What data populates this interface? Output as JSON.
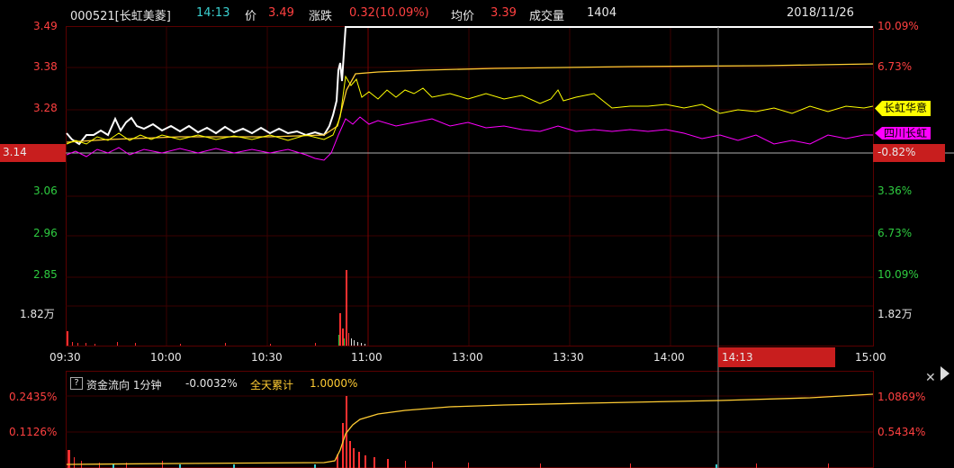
{
  "header": {
    "code_name": "000521[长虹美菱]",
    "time": "14:13",
    "price_label": "价",
    "price": "3.49",
    "change_label": "涨跌",
    "change": "0.32(10.09%)",
    "avg_label": "均价",
    "avg": "3.39",
    "volume_label": "成交量",
    "volume": "1404",
    "date": "2018/11/26"
  },
  "price_axis": {
    "left": [
      "3.49",
      "3.38",
      "3.28",
      "3.06",
      "2.96",
      "2.85",
      "1.82万"
    ],
    "right": [
      "10.09%",
      "6.73%",
      "3.36%",
      "6.73%",
      "10.09%",
      "1.82万"
    ],
    "prev_close": "3.14",
    "prev_close_pct": "-0.82%"
  },
  "time_axis": {
    "labels": [
      "09:30",
      "10:00",
      "10:30",
      "11:00",
      "13:00",
      "13:30",
      "14:00",
      "15:00"
    ],
    "cursor": "14:13"
  },
  "overlay_tags": [
    {
      "name": "长虹华意",
      "color": "#ffff00"
    },
    {
      "name": "四川长虹",
      "color": "#ff00ff"
    }
  ],
  "fund_panel": {
    "title": "资金流向 1分钟",
    "value": "-0.0032%",
    "cumulative_label": "全天累计",
    "cumulative": "1.0000%",
    "left_axis": [
      "0.2435%",
      "0.1126%"
    ],
    "right_axis": [
      "1.0869%",
      "0.5434%"
    ]
  },
  "colors": {
    "price_line": "#ffffff",
    "avg_line": "#ffcc33",
    "changhong_huayi": "#ffff00",
    "sichuan_changhong": "#ff00ff",
    "up": "#ff4040",
    "down": "#2ecc40",
    "grid": "#3a0000",
    "cursor_bg": "#c81e1e"
  },
  "chart_data": {
    "type": "line",
    "x_range": [
      "09:30",
      "15:00"
    ],
    "ylim": [
      2.85,
      3.49
    ],
    "prev_close": 3.14,
    "series": [
      {
        "name": "长虹华意",
        "values": [
          3.2,
          3.21,
          3.22,
          3.22,
          3.26,
          3.31,
          3.3,
          3.29,
          3.29,
          3.28,
          3.27,
          3.28
        ]
      },
      {
        "name": "四川长虹",
        "values": [
          3.17,
          3.17,
          3.18,
          3.18,
          3.2,
          3.24,
          3.22,
          3.22,
          3.21,
          3.21,
          3.21,
          3.22
        ]
      }
    ]
  }
}
